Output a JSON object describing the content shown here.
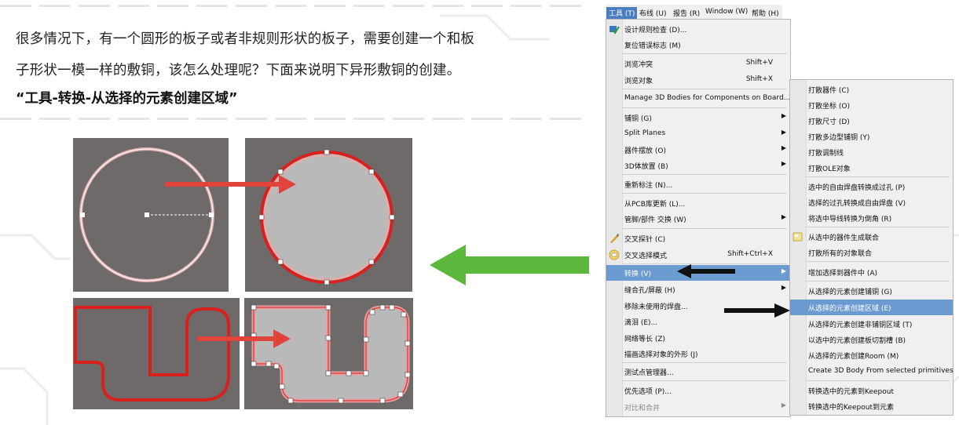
{
  "text": {
    "line1": "很多情况下，有一个圆形的板子或者非规则形状的板子，需要创建一个和板",
    "line2": "子形状一模一样的敷铜，该怎么处理呢？下面来说明下异形敷铜的创建。",
    "heading": "“工具-转换-从选择的元素创建区域”"
  },
  "menubar": [
    "工具 (T)",
    "布线 (U)",
    "报告 (R)",
    "Window (W)",
    "帮助 (H)"
  ],
  "tools_menu": [
    {
      "label": "设计规则检查 (D)..."
    },
    {
      "label": "复位错误标志 (M)"
    },
    {
      "label": "浏览冲突",
      "shortcut": "Shift+V"
    },
    {
      "label": "浏览对象",
      "shortcut": "Shift+X"
    },
    {
      "label": "Manage 3D Bodies for Components on Board..."
    },
    {
      "label": "铺铜 (G)"
    },
    {
      "label": "Split Planes"
    },
    {
      "label": "器件摆放 (O)"
    },
    {
      "label": "3D体放置 (B)"
    },
    {
      "label": "重新标注 (N)..."
    },
    {
      "label": "从PCB库更新 (L)..."
    },
    {
      "label": "管脚/部件 交换 (W)"
    },
    {
      "label": "交叉探针 (C)"
    },
    {
      "label": "交叉选择模式",
      "shortcut": "Shift+Ctrl+X"
    },
    {
      "label": "转换 (V)"
    },
    {
      "label": "缝合孔/屏蔽 (H)"
    },
    {
      "label": "移除未使用的焊盘..."
    },
    {
      "label": "滴泪 (E)..."
    },
    {
      "label": "网络等长 (Z)"
    },
    {
      "label": "描画选择对象的外形 (J)"
    },
    {
      "label": "测试点管理器..."
    },
    {
      "label": "优先选项 (P)..."
    },
    {
      "label": "对比和合并"
    }
  ],
  "convert_submenu": [
    "打散器件 (C)",
    "打散坐标 (O)",
    "打散尺寸 (D)",
    "打散多边型铺铜 (Y)",
    "打散调制线",
    "打散OLE对象",
    "选中的自由焊盘转换成过孔 (P)",
    "选择的过孔转换成自由焊盘 (V)",
    "将选中导线转换为倒角 (R)",
    "从选中的器件生成联合",
    "打散所有的对象联合",
    "增加选择到器件中 (A)",
    "从选择的元素创建铺铜 (G)",
    "从选择的元素创建区域 (E)",
    "从选择的元素创建非铺铜区域 (T)",
    "以选中的元素创建板切割槽 (B)",
    "从选择的元素创建Room (M)",
    "Create 3D Body From selected primitives",
    "转换选中的元素到Keepout",
    "转换选中的Keepout到元素"
  ],
  "colors": {
    "panel_bg": "#6e6a69",
    "outline_red": "#d8201f",
    "region_fill": "#b9b9b9",
    "arrow_red": "#e0443a",
    "arrow_green": "#5cb83c",
    "highlight": "#6b9bd1"
  }
}
